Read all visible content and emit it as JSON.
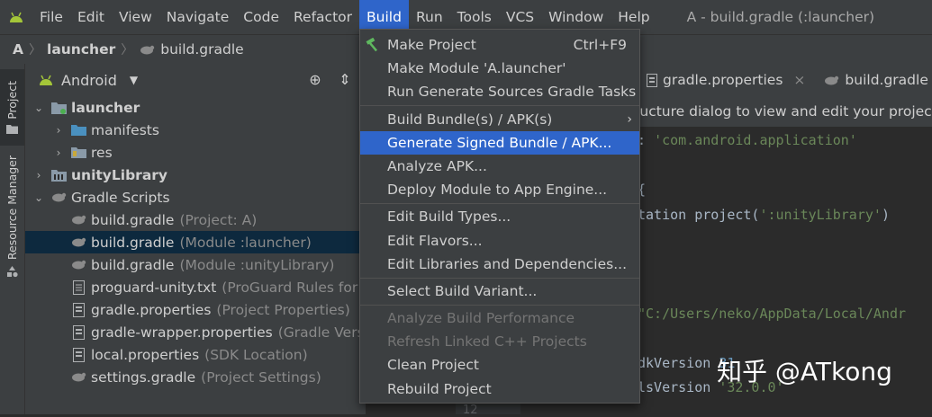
{
  "menubar": {
    "items": [
      "File",
      "Edit",
      "View",
      "Navigate",
      "Code",
      "Refactor",
      "Build",
      "Run",
      "Tools",
      "VCS",
      "Window",
      "Help"
    ],
    "active": "Build",
    "window_title": "A - build.gradle (:launcher)"
  },
  "breadcrumb": [
    "A",
    "launcher",
    "build.gradle"
  ],
  "left_strip": {
    "project_tab": "Project",
    "resource_manager_tab": "Resource Manager"
  },
  "project_panel": {
    "view_selector": "Android",
    "tree": [
      {
        "name": "launcher",
        "hint": ""
      },
      {
        "name": "manifests",
        "hint": ""
      },
      {
        "name": "res",
        "hint": ""
      },
      {
        "name": "unityLibrary",
        "hint": ""
      },
      {
        "name": "Gradle Scripts",
        "hint": ""
      },
      {
        "name": "build.gradle",
        "hint": "(Project: A)"
      },
      {
        "name": "build.gradle",
        "hint": "(Module :launcher)"
      },
      {
        "name": "build.gradle",
        "hint": "(Module :unityLibrary)"
      },
      {
        "name": "proguard-unity.txt",
        "hint": "(ProGuard Rules for \":"
      },
      {
        "name": "gradle.properties",
        "hint": "(Project Properties)"
      },
      {
        "name": "gradle-wrapper.properties",
        "hint": "(Gradle Versio"
      },
      {
        "name": "local.properties",
        "hint": "(SDK Location)"
      },
      {
        "name": "settings.gradle",
        "hint": "(Project Settings)"
      }
    ]
  },
  "editor": {
    "tabs": [
      {
        "label": "gradle.properties",
        "close": "×"
      },
      {
        "label": "build.gradle (:u"
      }
    ],
    "notice": "ructure dialog to view and edit your project c",
    "lines": {
      "l1a": ": ",
      "l1b": "'com.android.application'",
      "l2": " {",
      "l3a": "tation project(",
      "l3b": "':unityLibrary'",
      "l3c": ")",
      "l4": "\"C:/Users/neko/AppData/Local/Andr",
      "l5a": "dkVersion ",
      "l5b": "31",
      "l6a": "lsVersion ",
      "l6b": "'32.0.0'"
    },
    "gutter_line": "12"
  },
  "watermark": "知乎 @ATkong",
  "build_menu": {
    "items": [
      {
        "label": "Make Project",
        "shortcut": "Ctrl+F9"
      },
      {
        "label": "Make Module 'A.launcher'"
      },
      {
        "label": "Run Generate Sources Gradle Tasks"
      },
      {
        "label": "Build Bundle(s) / APK(s)",
        "submenu": "›"
      },
      {
        "label": "Generate Signed Bundle / APK..."
      },
      {
        "label": "Analyze APK..."
      },
      {
        "label": "Deploy Module to App Engine..."
      },
      {
        "label": "Edit Build Types..."
      },
      {
        "label": "Edit Flavors..."
      },
      {
        "label": "Edit Libraries and Dependencies..."
      },
      {
        "label": "Select Build Variant..."
      },
      {
        "label": "Analyze Build Performance"
      },
      {
        "label": "Refresh Linked C++ Projects"
      },
      {
        "label": "Clean Project"
      },
      {
        "label": "Rebuild Project"
      }
    ],
    "highlighted": "Generate Signed Bundle / APK...",
    "disabled": [
      "Analyze Build Performance",
      "Refresh Linked C++ Projects"
    ]
  },
  "colors": {
    "menu_highlight": "#2f65ca",
    "selection": "#0d293e",
    "android_green": "#a4c639",
    "folder_blue": "#4a90bf",
    "string_green": "#6a8759"
  }
}
